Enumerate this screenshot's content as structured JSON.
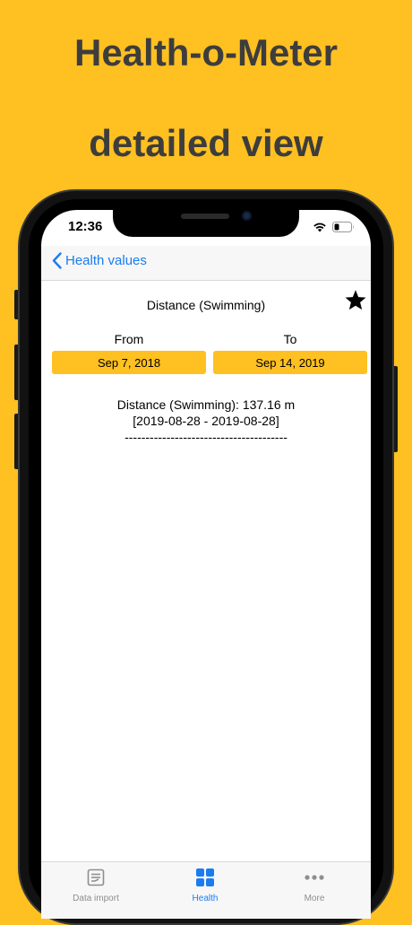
{
  "promo": {
    "title_line1": "Health-o-Meter",
    "title_line2": "detailed view"
  },
  "status_bar": {
    "time": "12:36"
  },
  "nav": {
    "back_label": "Health values"
  },
  "detail": {
    "metric_title": "Distance (Swimming)",
    "from_label": "From",
    "to_label": "To",
    "from_date": "Sep 7, 2018",
    "to_date": "Sep 14, 2019",
    "result_line1": "Distance (Swimming): 137.16 m",
    "result_line2": "[2019-08-28 - 2019-08-28]",
    "result_divider": "---------------------------------------"
  },
  "tab_bar": {
    "tabs": [
      {
        "label": "Data import",
        "icon": "document-icon"
      },
      {
        "label": "Health",
        "icon": "grid-icon"
      },
      {
        "label": "More",
        "icon": "more-icon"
      }
    ]
  },
  "colors": {
    "background": "#FFC021",
    "accent": "#1a7cf0",
    "button": "#FFC021"
  }
}
